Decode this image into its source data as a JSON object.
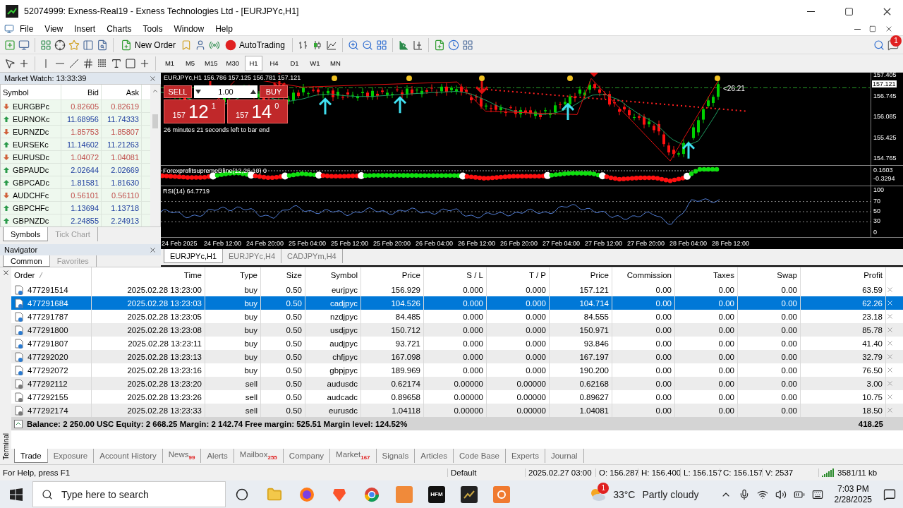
{
  "window": {
    "title": "52074999: Exness-Real19 - Exness Technologies Ltd - [EURJPYc,H1]"
  },
  "menu": [
    "File",
    "View",
    "Insert",
    "Charts",
    "Tools",
    "Window",
    "Help"
  ],
  "toolbar": {
    "new_order": "New Order",
    "auto_trading": "AutoTrading",
    "alerts_badge": "1",
    "timeframes": [
      {
        "label": "M1",
        "selected": false
      },
      {
        "label": "M5",
        "selected": false
      },
      {
        "label": "M15",
        "selected": false
      },
      {
        "label": "M30",
        "selected": false
      },
      {
        "label": "H1",
        "selected": true
      },
      {
        "label": "H4",
        "selected": false
      },
      {
        "label": "D1",
        "selected": false
      },
      {
        "label": "W1",
        "selected": false
      },
      {
        "label": "MN",
        "selected": false
      }
    ]
  },
  "market_watch": {
    "title": "Market Watch: 13:33:39",
    "columns": [
      "Symbol",
      "Bid",
      "Ask"
    ],
    "rows": [
      {
        "symbol": "EURGBPc",
        "bid": "0.82605",
        "ask": "0.82619",
        "kind": "down"
      },
      {
        "symbol": "EURNOKc",
        "bid": "11.68956",
        "ask": "11.74333",
        "kind": "up"
      },
      {
        "symbol": "EURNZDc",
        "bid": "1.85753",
        "ask": "1.85807",
        "kind": "down"
      },
      {
        "symbol": "EURSEKc",
        "bid": "11.14602",
        "ask": "11.21263",
        "kind": "up"
      },
      {
        "symbol": "EURUSDc",
        "bid": "1.04072",
        "ask": "1.04081",
        "kind": "down"
      },
      {
        "symbol": "GBPAUDc",
        "bid": "2.02644",
        "ask": "2.02669",
        "kind": "up"
      },
      {
        "symbol": "GBPCADc",
        "bid": "1.81581",
        "ask": "1.81630",
        "kind": "up"
      },
      {
        "symbol": "AUDCHFc",
        "bid": "0.56101",
        "ask": "0.56110",
        "kind": "down"
      },
      {
        "symbol": "GBPCHFc",
        "bid": "1.13694",
        "ask": "1.13718",
        "kind": "up"
      },
      {
        "symbol": "GBPNZDc",
        "bid": "2.24855",
        "ask": "2.24913",
        "kind": "up"
      }
    ],
    "tabs": [
      {
        "label": "Symbols",
        "selected": true
      },
      {
        "label": "Tick Chart",
        "selected": false
      }
    ]
  },
  "navigator": {
    "title": "Navigator",
    "tabs": [
      {
        "label": "Common",
        "selected": true
      },
      {
        "label": "Favorites",
        "selected": false
      }
    ]
  },
  "chart": {
    "header": "EURJPYc,H1  156.786 157.125 156.781 157.121",
    "trade_panel": {
      "sell": "SELL",
      "buy": "BUY",
      "lot": "1.00",
      "sell_price": [
        "157",
        "12",
        "1"
      ],
      "buy_price": [
        "157",
        "14",
        "0"
      ]
    },
    "countdown": "26 minutes 21 seconds left to bar end",
    "profit_label": "<26.21",
    "price_axis": [
      "157.405",
      "156.745",
      "156.085",
      "155.425",
      "154.765"
    ],
    "current_price": "157.121",
    "indicator_title": "ForexprofitsupremeDline(12,26,10) 0",
    "indicator_axis": [
      "0.1603",
      "-0.3294"
    ],
    "rsi_title": "RSI(14) 64.7719",
    "rsi_axis": [
      "100",
      "70",
      "50",
      "30",
      "0"
    ],
    "time_axis": [
      "24 Feb 2025",
      "24 Feb 12:00",
      "24 Feb 20:00",
      "25 Feb 04:00",
      "25 Feb 12:00",
      "25 Feb 20:00",
      "26 Feb 04:00",
      "26 Feb 12:00",
      "26 Feb 20:00",
      "27 Feb 04:00",
      "27 Feb 12:00",
      "27 Feb 20:00",
      "28 Feb 04:00",
      "28 Feb 12:00"
    ],
    "tabs": [
      {
        "label": "EURJPYc,H1",
        "selected": true
      },
      {
        "label": "EURJPYc,H4",
        "selected": false
      },
      {
        "label": "CADJPYm,H4",
        "selected": false
      }
    ]
  },
  "terminal": {
    "side_label": "Terminal",
    "columns": [
      "Order",
      "Time",
      "Type",
      "Size",
      "Symbol",
      "Price",
      "S / L",
      "T / P",
      "Price",
      "Commission",
      "Taxes",
      "Swap",
      "Profit"
    ],
    "rows": [
      {
        "order": "477291514",
        "time": "2025.02.28 13:23:00",
        "type": "buy",
        "size": "0.50",
        "symbol": "eurjpyc",
        "price": "156.929",
        "sl": "0.000",
        "tp": "0.000",
        "current_price": "157.121",
        "commission": "0.00",
        "taxes": "0.00",
        "swap": "0.00",
        "profit": "63.59",
        "kind": "buy",
        "selected": false
      },
      {
        "order": "477291684",
        "time": "2025.02.28 13:23:03",
        "type": "buy",
        "size": "0.50",
        "symbol": "cadjpyc",
        "price": "104.526",
        "sl": "0.000",
        "tp": "0.000",
        "current_price": "104.714",
        "commission": "0.00",
        "taxes": "0.00",
        "swap": "0.00",
        "profit": "62.26",
        "kind": "buy",
        "selected": true
      },
      {
        "order": "477291787",
        "time": "2025.02.28 13:23:05",
        "type": "buy",
        "size": "0.50",
        "symbol": "nzdjpyc",
        "price": "84.485",
        "sl": "0.000",
        "tp": "0.000",
        "current_price": "84.555",
        "commission": "0.00",
        "taxes": "0.00",
        "swap": "0.00",
        "profit": "23.18",
        "kind": "buy",
        "selected": false
      },
      {
        "order": "477291800",
        "time": "2025.02.28 13:23:08",
        "type": "buy",
        "size": "0.50",
        "symbol": "usdjpyc",
        "price": "150.712",
        "sl": "0.000",
        "tp": "0.000",
        "current_price": "150.971",
        "commission": "0.00",
        "taxes": "0.00",
        "swap": "0.00",
        "profit": "85.78",
        "kind": "buy",
        "selected": false
      },
      {
        "order": "477291807",
        "time": "2025.02.28 13:23:11",
        "type": "buy",
        "size": "0.50",
        "symbol": "audjpyc",
        "price": "93.721",
        "sl": "0.000",
        "tp": "0.000",
        "current_price": "93.846",
        "commission": "0.00",
        "taxes": "0.00",
        "swap": "0.00",
        "profit": "41.40",
        "kind": "buy",
        "selected": false
      },
      {
        "order": "477292020",
        "time": "2025.02.28 13:23:13",
        "type": "buy",
        "size": "0.50",
        "symbol": "chfjpyc",
        "price": "167.098",
        "sl": "0.000",
        "tp": "0.000",
        "current_price": "167.197",
        "commission": "0.00",
        "taxes": "0.00",
        "swap": "0.00",
        "profit": "32.79",
        "kind": "buy",
        "selected": false
      },
      {
        "order": "477292072",
        "time": "2025.02.28 13:23:16",
        "type": "buy",
        "size": "0.50",
        "symbol": "gbpjpyc",
        "price": "189.969",
        "sl": "0.000",
        "tp": "0.000",
        "current_price": "190.200",
        "commission": "0.00",
        "taxes": "0.00",
        "swap": "0.00",
        "profit": "76.50",
        "kind": "buy",
        "selected": false
      },
      {
        "order": "477292112",
        "time": "2025.02.28 13:23:20",
        "type": "sell",
        "size": "0.50",
        "symbol": "audusdc",
        "price": "0.62174",
        "sl": "0.00000",
        "tp": "0.00000",
        "current_price": "0.62168",
        "commission": "0.00",
        "taxes": "0.00",
        "swap": "0.00",
        "profit": "3.00",
        "kind": "sell",
        "selected": false
      },
      {
        "order": "477292155",
        "time": "2025.02.28 13:23:26",
        "type": "sell",
        "size": "0.50",
        "symbol": "audcadc",
        "price": "0.89658",
        "sl": "0.00000",
        "tp": "0.00000",
        "current_price": "0.89627",
        "commission": "0.00",
        "taxes": "0.00",
        "swap": "0.00",
        "profit": "10.75",
        "kind": "sell",
        "selected": false
      },
      {
        "order": "477292174",
        "time": "2025.02.28 13:23:33",
        "type": "sell",
        "size": "0.50",
        "symbol": "eurusdc",
        "price": "1.04118",
        "sl": "0.00000",
        "tp": "0.00000",
        "current_price": "1.04081",
        "commission": "0.00",
        "taxes": "0.00",
        "swap": "0.00",
        "profit": "18.50",
        "kind": "sell",
        "selected": false
      }
    ],
    "summary": "Balance: 2 250.00 USC  Equity: 2 668.25  Margin: 2 142.74  Free margin: 525.51  Margin level: 124.52%",
    "total_profit": "418.25",
    "tabs": [
      {
        "label": "Trade",
        "selected": true
      },
      {
        "label": "Exposure",
        "selected": false
      },
      {
        "label": "Account History",
        "selected": false
      },
      {
        "label": "News",
        "badge": "99",
        "selected": false
      },
      {
        "label": "Alerts",
        "selected": false
      },
      {
        "label": "Mailbox",
        "badge": "255",
        "selected": false
      },
      {
        "label": "Company",
        "selected": false
      },
      {
        "label": "Market",
        "badge": "167",
        "selected": false
      },
      {
        "label": "Signals",
        "selected": false
      },
      {
        "label": "Articles",
        "selected": false
      },
      {
        "label": "Code Base",
        "selected": false
      },
      {
        "label": "Experts",
        "selected": false
      },
      {
        "label": "Journal",
        "selected": false
      }
    ]
  },
  "status_bar": [
    "For Help, press F1",
    "Default",
    "2025.02.27 03:00",
    "O: 156.287",
    "H: 156.400",
    "L: 156.157",
    "C: 156.157",
    "V: 2537",
    "3581/11 kb"
  ],
  "taskbar": {
    "search_placeholder": "Type here to search",
    "app_label": "HFM",
    "weather_badge": "1",
    "temperature": "33°C",
    "weather": "Partly cloudy",
    "time": "7:03 PM",
    "date": "2/28/2025"
  }
}
